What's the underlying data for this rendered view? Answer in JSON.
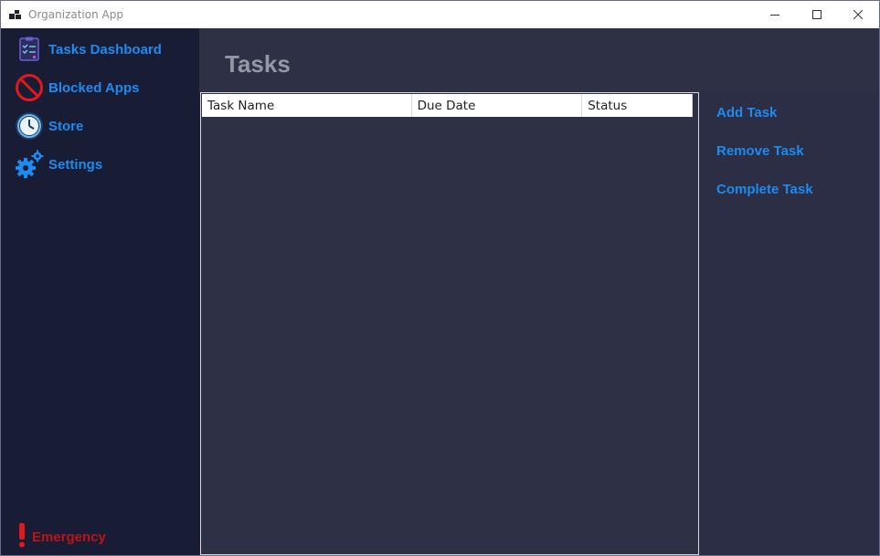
{
  "window": {
    "title": "Organization App",
    "controls": [
      "minimize-icon",
      "maximize-icon",
      "close-icon"
    ]
  },
  "sidebar": {
    "items": [
      {
        "label": "Tasks Dashboard",
        "icon": "clipboard-checklist-icon"
      },
      {
        "label": "Blocked Apps",
        "icon": "prohibited-icon"
      },
      {
        "label": "Store",
        "icon": "clock-icon"
      },
      {
        "label": "Settings",
        "icon": "gears-icon"
      }
    ],
    "emergency": {
      "label": "Emergency",
      "icon": "exclamation-icon"
    }
  },
  "main": {
    "title": "Tasks",
    "table": {
      "columns": [
        "Task Name",
        "Due Date",
        "Status"
      ],
      "rows": []
    }
  },
  "actions": {
    "add": "Add Task",
    "remove": "Remove Task",
    "complete": "Complete Task"
  },
  "colors": {
    "accent": "#1d8bf0",
    "danger": "#c01414",
    "sidebar_bg": "#191c35",
    "content_bg": "#2e3146"
  }
}
